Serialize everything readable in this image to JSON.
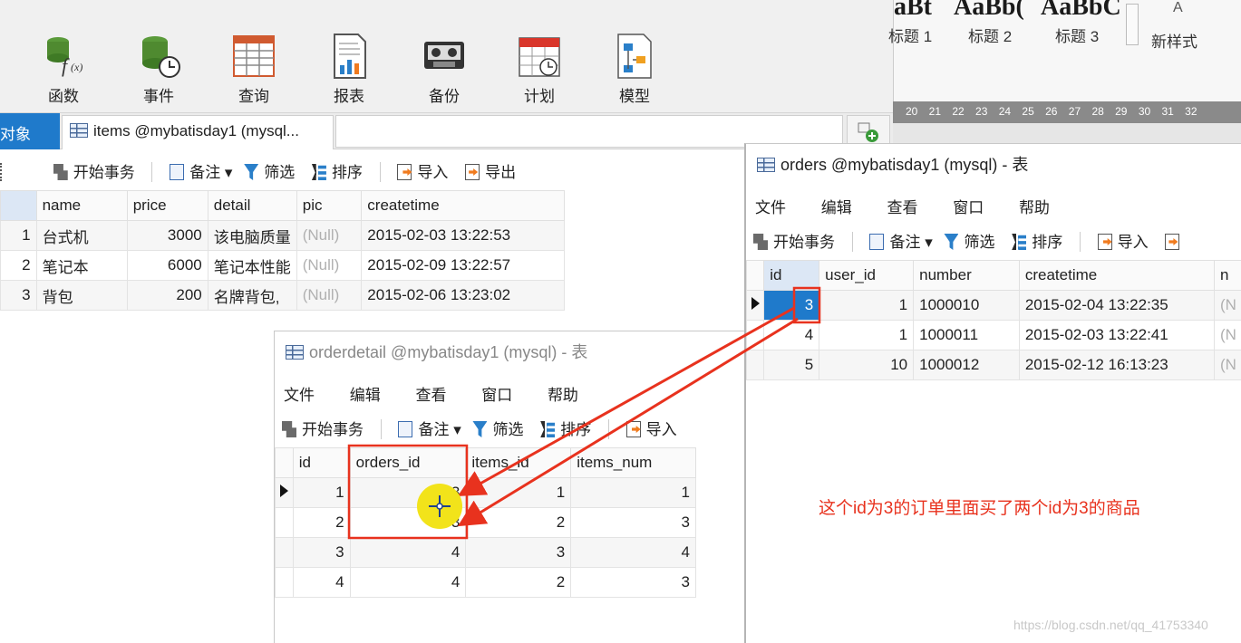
{
  "toolbar": {
    "tools": [
      {
        "name": "function",
        "label": "函数",
        "icon": "function-icon"
      },
      {
        "name": "event",
        "label": "事件",
        "icon": "event-icon"
      },
      {
        "name": "query",
        "label": "查询",
        "icon": "query-icon"
      },
      {
        "name": "report",
        "label": "报表",
        "icon": "report-icon"
      },
      {
        "name": "backup",
        "label": "备份",
        "icon": "backup-icon"
      },
      {
        "name": "schedule",
        "label": "计划",
        "icon": "schedule-icon"
      },
      {
        "name": "model",
        "label": "模型",
        "icon": "model-icon"
      }
    ]
  },
  "word_ribbon": {
    "samples": [
      "aBt",
      "AaBb(",
      "AaBbC"
    ],
    "styles": [
      "标题 1",
      "标题 2",
      "标题 3"
    ],
    "new_style": "新样式",
    "ruler": "20 21 22 23 24 25 26 27 28 29 30 31 32"
  },
  "tabs": {
    "objects": "对象",
    "items": "items @mybatisday1 (mysql..."
  },
  "actions": {
    "begin_tx": "开始事务",
    "note": "备注",
    "filter": "筛选",
    "sort": "排序",
    "import": "导入",
    "export": "导出"
  },
  "menu": {
    "file": "文件",
    "edit": "编辑",
    "view": "查看",
    "window": "窗口",
    "help": "帮助"
  },
  "items_table": {
    "columns": [
      "name",
      "price",
      "detail",
      "pic",
      "createtime"
    ],
    "rows": [
      {
        "id": "1",
        "name": "台式机",
        "price": "3000",
        "detail": "该电脑质量",
        "pic": "(Null)",
        "createtime": "2015-02-03 13:22:53"
      },
      {
        "id": "2",
        "name": "笔记本",
        "price": "6000",
        "detail": "笔记本性能",
        "pic": "(Null)",
        "createtime": "2015-02-09 13:22:57"
      },
      {
        "id": "3",
        "name": "背包",
        "price": "200",
        "detail": "名牌背包,",
        "pic": "(Null)",
        "createtime": "2015-02-06 13:23:02"
      }
    ]
  },
  "orders_window": {
    "title": "orders @mybatisday1 (mysql) - 表",
    "columns": [
      "id",
      "user_id",
      "number",
      "createtime",
      "n"
    ],
    "rows": [
      {
        "id": "3",
        "user_id": "1",
        "number": "1000010",
        "createtime": "2015-02-04 13:22:35",
        "n": "(N"
      },
      {
        "id": "4",
        "user_id": "1",
        "number": "1000011",
        "createtime": "2015-02-03 13:22:41",
        "n": "(N"
      },
      {
        "id": "5",
        "user_id": "10",
        "number": "1000012",
        "createtime": "2015-02-12 16:13:23",
        "n": "(N"
      }
    ]
  },
  "orderdetail_window": {
    "title": "orderdetail @mybatisday1 (mysql) - 表",
    "columns": [
      "id",
      "orders_id",
      "items_id",
      "items_num"
    ],
    "rows": [
      {
        "id": "1",
        "orders_id": "3",
        "items_id": "1",
        "items_num": "1"
      },
      {
        "id": "2",
        "orders_id": "3",
        "items_id": "2",
        "items_num": "3"
      },
      {
        "id": "3",
        "orders_id": "4",
        "items_id": "3",
        "items_num": "4"
      },
      {
        "id": "4",
        "orders_id": "4",
        "items_id": "2",
        "items_num": "3"
      }
    ]
  },
  "annotation": "这个id为3的订单里面买了两个id为3的商品",
  "watermark": "https://blog.csdn.net/qq_41753340",
  "colors": {
    "accent": "#1f7acb",
    "annotation": "#e8321e",
    "selection": "#1f7acb"
  }
}
